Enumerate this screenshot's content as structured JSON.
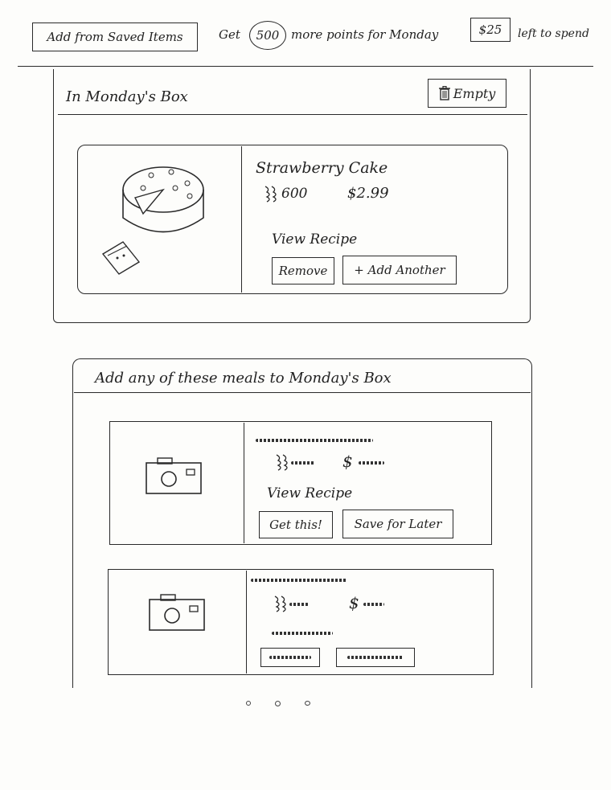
{
  "header": {
    "saved_button": "Add from Saved Items",
    "points_prefix": "Get",
    "points_value": "500",
    "points_suffix": "more points for Monday",
    "budget_value": "$25",
    "budget_suffix": "left to spend"
  },
  "box": {
    "title": "In Monday's Box",
    "empty_button": "Empty",
    "item": {
      "name": "Strawberry Cake",
      "points": "600",
      "price": "$2.99",
      "view_recipe": "View Recipe",
      "remove_button": "Remove",
      "add_another_button": "+ Add Another"
    }
  },
  "suggestions": {
    "title": "Add any of these meals to Monday's Box",
    "items": [
      {
        "price_symbol": "$",
        "view_recipe": "View Recipe",
        "get_button": "Get this!",
        "save_button": "Save for Later"
      },
      {
        "price_symbol": "$"
      }
    ]
  },
  "icons": {
    "trash": "trash-icon",
    "points": "points-icon",
    "camera": "camera-icon",
    "cake": "cake-image"
  }
}
